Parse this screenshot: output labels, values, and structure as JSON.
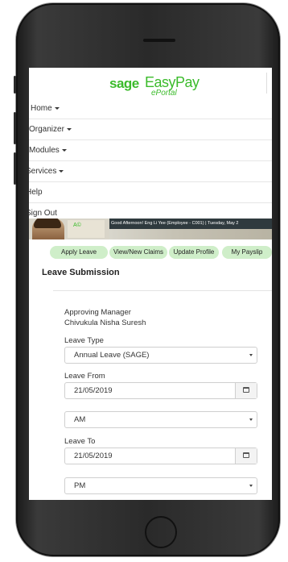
{
  "app": {
    "logo_sage": "sage",
    "logo_easypay": "EasyPay",
    "logo_eportal": "ePortal",
    "brand_color": "#3bbb2b"
  },
  "nav": {
    "items": [
      {
        "label": "Home",
        "dropdown": true
      },
      {
        "label": "Organizer",
        "dropdown": true
      },
      {
        "label": "Modules",
        "dropdown": true
      },
      {
        "label": "Services",
        "dropdown": true
      },
      {
        "label": "Help",
        "dropdown": false
      },
      {
        "label": "Sign Out",
        "dropdown": false
      }
    ]
  },
  "banner": {
    "greeting": "Good Afternoon! Eng Li Yee (Employee - C001) | Tuesday, May 2"
  },
  "quick_links": [
    {
      "label": "Apply Leave"
    },
    {
      "label": "View/New Claims"
    },
    {
      "label": "Update Profile"
    },
    {
      "label": "My Payslip"
    }
  ],
  "form": {
    "title": "Leave Submission",
    "approving_manager_label": "Approving Manager",
    "approving_manager_value": "Chivukula Nisha Suresh",
    "leave_type_label": "Leave Type",
    "leave_type_value": "Annual Leave (SAGE)",
    "leave_from_label": "Leave From",
    "leave_from_value": "21/05/2019",
    "leave_from_session": "AM",
    "leave_to_label": "Leave To",
    "leave_to_value": "21/05/2019",
    "leave_to_session": "PM"
  }
}
